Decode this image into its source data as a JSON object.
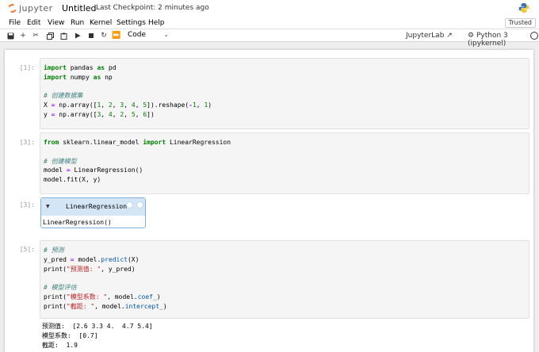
{
  "header": {
    "logo_text": "jupyter",
    "notebook_name": "Untitled",
    "checkpoint": "Last Checkpoint: 2 minutes ago"
  },
  "menu": [
    "File",
    "Edit",
    "View",
    "Run",
    "Kernel",
    "Settings",
    "Help"
  ],
  "trusted_label": "Trusted",
  "toolbar": {
    "cell_type": "Code",
    "jupyterlab_label": "JupyterLab",
    "kernel_label": "Python 3 (ipykernel)"
  },
  "cells": [
    {
      "prompt": "[1]:",
      "lines": [
        "import pandas as pd",
        "import numpy as np",
        "",
        "# 创建数据集",
        "X = np.array([1, 2, 3, 4, 5]).reshape(-1, 1)",
        "y = np.array([3, 4, 2, 5, 6])"
      ]
    },
    {
      "prompt": "[3]:",
      "lines": [
        "from sklearn.linear_model import LinearRegression",
        "",
        "# 创建模型",
        "model = LinearRegression()",
        "model.fit(X, y)"
      ]
    },
    {
      "prompt": "[5]:",
      "lines": [
        "# 预测",
        "y_pred = model.predict(X)",
        "print(\"预测值: \", y_pred)",
        "",
        "# 模型评估",
        "print(\"模型系数: \", model.coef_)",
        "print(\"截距: \", model.intercept_)"
      ]
    }
  ],
  "widget": {
    "prompt": "[3]:",
    "title": "LinearRegression",
    "text": "LinearRegression()"
  },
  "output_lines": [
    "预测值:  [2.6 3.3 4.  4.7 5.4]",
    "模型系数:  [0.7]",
    "截距:  1.9"
  ]
}
